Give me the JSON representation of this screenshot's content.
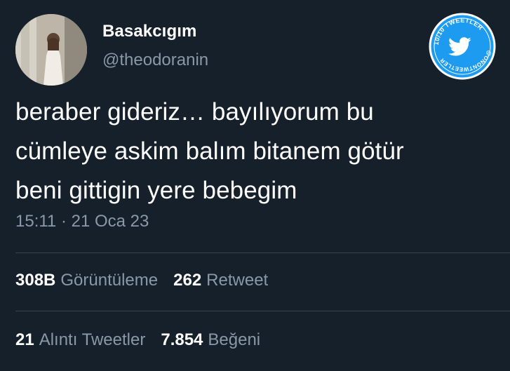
{
  "user": {
    "display_name": "Basakcıgım",
    "handle": "@theodoranin"
  },
  "badge": {
    "top_text": "10/10 TWEETLER",
    "bottom_text": "@ONONTWEETLER",
    "icon": "twitter-bird-icon"
  },
  "tweet": {
    "text": "beraber gideriz… bayılıyorum bu\ncümleye askim balım bitanem götür\nbeni gittigin yere bebegim",
    "timestamp": "15:11 · 21 Oca 23"
  },
  "stats": {
    "views_value": "308B",
    "views_label": "Görüntüleme",
    "retweets_value": "262",
    "retweets_label": "Retweet",
    "quotes_value": "21",
    "quotes_label": "Alıntı Tweetler",
    "likes_value": "7.854",
    "likes_label": "Beğeni"
  },
  "colors": {
    "background": "#15202b",
    "secondary_text": "#8b98a5",
    "divider": "#38444d",
    "badge_blue": "#1d9bf0"
  }
}
